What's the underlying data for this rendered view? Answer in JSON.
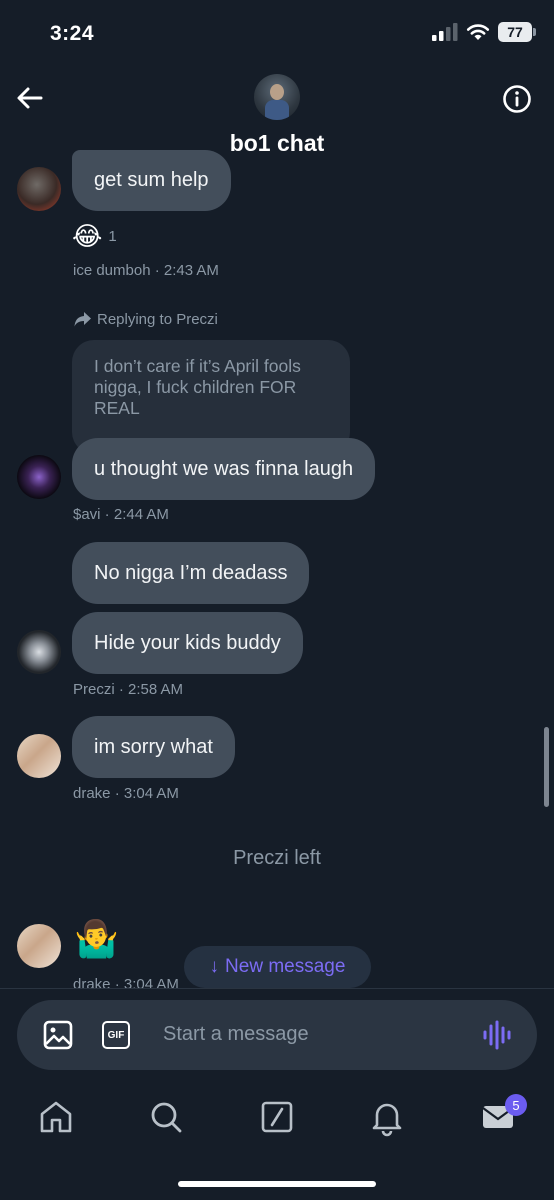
{
  "status_bar": {
    "time": "3:24",
    "battery": "77"
  },
  "header": {
    "title": "bo1 chat"
  },
  "messages": [
    {
      "text": "get sum help",
      "reaction_emoji": "😂",
      "reaction_count": "1",
      "meta": "ice dumboh · 2:43 AM"
    },
    {
      "reply_label": "Replying to Preczi",
      "quoted": "I don’t care if it’s April fools nigga, I fuck children FOR REAL",
      "text": "u thought we was finna laugh",
      "meta": "$avi · 2:44 AM"
    },
    {
      "text": "No nigga I’m deadass"
    },
    {
      "text": "Hide your kids buddy",
      "meta": "Preczi · 2:58 AM"
    },
    {
      "text": "im sorry what",
      "meta": "drake · 3:04 AM"
    },
    {
      "emoji": "🤷‍♂️",
      "meta": "drake · 3:04 AM"
    }
  ],
  "system_message": "Preczi left",
  "new_message_pill": {
    "arrow": "↓",
    "label": "New message"
  },
  "composer": {
    "placeholder": "Start a message",
    "gif_label": "GIF"
  },
  "nav": {
    "messages_badge": "5"
  },
  "colors": {
    "background": "#151d28",
    "bubble": "#434e5b",
    "accent": "#7c6cf4",
    "muted": "#8b98a5"
  }
}
